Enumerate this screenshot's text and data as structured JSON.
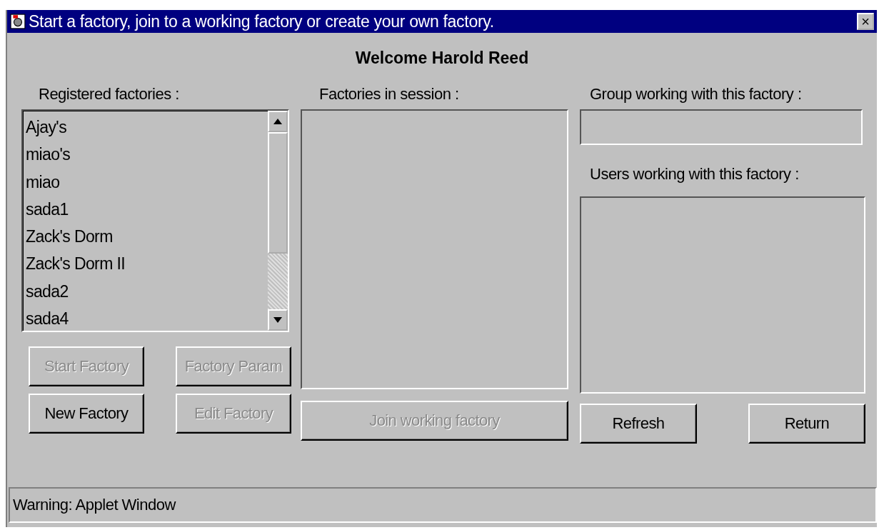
{
  "window": {
    "title": "Start a factory, join to a working factory or create your own factory.",
    "close": "×"
  },
  "welcome": "Welcome Harold Reed",
  "registered": {
    "label": "Registered factories :",
    "items": [
      {
        "name": "Ajay's",
        "selected": false
      },
      {
        "name": "miao's",
        "selected": false
      },
      {
        "name": "miao",
        "selected": false
      },
      {
        "name": "sada1",
        "selected": false
      },
      {
        "name": "Zack's Dorm",
        "selected": false
      },
      {
        "name": "Zack's Dorm II",
        "selected": false
      },
      {
        "name": "sada2",
        "selected": false
      },
      {
        "name": "sada4",
        "selected": false
      }
    ],
    "buttons": [
      {
        "label": "Start Factory",
        "disabled": true
      },
      {
        "label": "Factory Param",
        "disabled": true
      },
      {
        "label": "New Factory",
        "disabled": false
      },
      {
        "label": "Edit Factory",
        "disabled": true
      }
    ]
  },
  "session": {
    "label": "Factories in session :",
    "button": {
      "label": "Join working factory",
      "disabled": true
    }
  },
  "group": {
    "label": "Group working with this factory :"
  },
  "users": {
    "label": "Users working with this factory :",
    "buttons": [
      {
        "label": "Refresh",
        "disabled": false
      },
      {
        "label": "Return",
        "disabled": false
      }
    ]
  },
  "status_bar": "Warning: Applet Window"
}
